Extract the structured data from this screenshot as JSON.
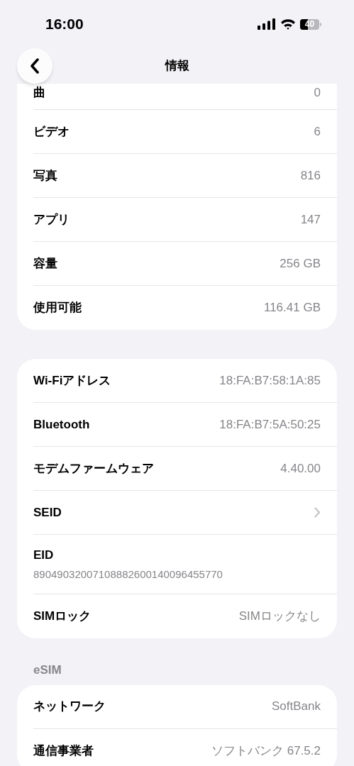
{
  "status_bar": {
    "time": "16:00",
    "battery": "40"
  },
  "nav": {
    "title": "情報"
  },
  "sections": [
    {
      "rows": [
        {
          "kind": "value",
          "label": "曲",
          "value": "0"
        },
        {
          "kind": "value",
          "label": "ビデオ",
          "value": "6"
        },
        {
          "kind": "value",
          "label": "写真",
          "value": "816"
        },
        {
          "kind": "value",
          "label": "アプリ",
          "value": "147"
        },
        {
          "kind": "value",
          "label": "容量",
          "value": "256 GB"
        },
        {
          "kind": "value",
          "label": "使用可能",
          "value": "116.41 GB"
        }
      ]
    },
    {
      "rows": [
        {
          "kind": "value",
          "label": "Wi-Fiアドレス",
          "value": "18:FA:B7:58:1A:85"
        },
        {
          "kind": "value",
          "label": "Bluetooth",
          "value": "18:FA:B7:5A:50:25"
        },
        {
          "kind": "value",
          "label": "モデムファームウェア",
          "value": "4.40.00"
        },
        {
          "kind": "chevron",
          "label": "SEID"
        },
        {
          "kind": "stacked",
          "label": "EID",
          "value": "89049032007108882600140096455770"
        },
        {
          "kind": "value",
          "label": "SIMロック",
          "value": "SIMロックなし"
        }
      ]
    },
    {
      "header": "eSIM",
      "rows": [
        {
          "kind": "value",
          "label": "ネットワーク",
          "value": "SoftBank"
        },
        {
          "kind": "value",
          "label": "通信事業者",
          "value": "ソフトバンク 67.5.2"
        }
      ]
    }
  ]
}
